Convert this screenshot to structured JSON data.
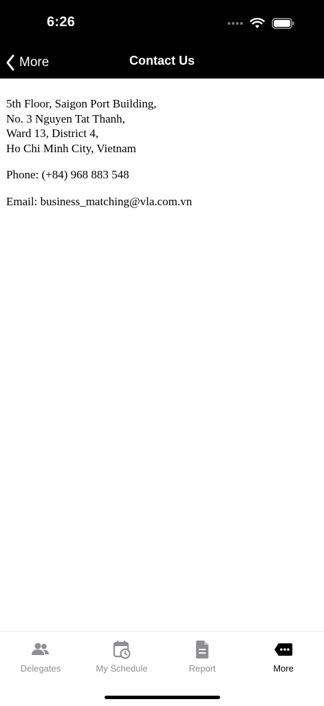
{
  "status_bar": {
    "time": "6:26"
  },
  "nav": {
    "back_label": "More",
    "title": "Contact Us"
  },
  "contact": {
    "address": [
      "5th Floor, Saigon Port Building,",
      "No. 3 Nguyen Tat Thanh,",
      "Ward 13, District 4,",
      "Ho Chi Minh City, Vietnam"
    ],
    "phone": "Phone: (+84) 968 883 548",
    "email": "Email: business_matching@vla.com.vn"
  },
  "tabbar": {
    "items": [
      {
        "label": "Delegates",
        "icon": "people-icon",
        "active": false
      },
      {
        "label": "My Schedule",
        "icon": "calendar-clock-icon",
        "active": false
      },
      {
        "label": "Report",
        "icon": "document-icon",
        "active": false
      },
      {
        "label": "More",
        "icon": "more-icon",
        "active": true
      }
    ]
  },
  "colors": {
    "header_bg": "#000000",
    "inactive_tab": "#8e8e93",
    "active_tab": "#000000"
  }
}
